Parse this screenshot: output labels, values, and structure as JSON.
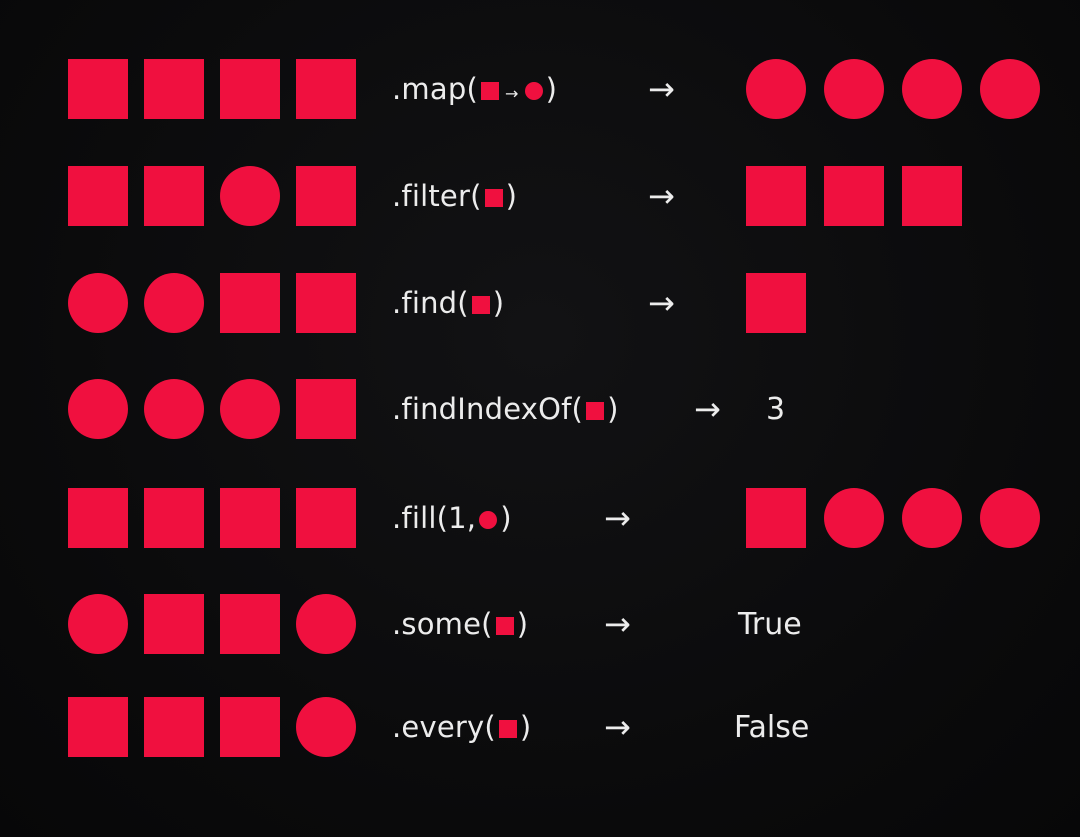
{
  "accent_color": "#f0103f",
  "arrow_glyph": "→",
  "rows": [
    {
      "id": "map",
      "input": [
        "square",
        "square",
        "square",
        "square"
      ],
      "method_prefix": ".map(",
      "method_args": [
        "square",
        "mini-arrow",
        "circle"
      ],
      "mini_arrow": "→",
      "method_suffix": ")",
      "output": [
        "circle",
        "circle",
        "circle",
        "circle"
      ],
      "result_text": ""
    },
    {
      "id": "filter",
      "input": [
        "square",
        "square",
        "circle",
        "square"
      ],
      "method_prefix": ".filter(",
      "method_args": [
        "square"
      ],
      "method_suffix": ")",
      "output": [
        "square",
        "square",
        "square"
      ],
      "result_text": ""
    },
    {
      "id": "find",
      "input": [
        "circle",
        "circle",
        "square",
        "square"
      ],
      "method_prefix": ".find(",
      "method_args": [
        "square"
      ],
      "method_suffix": ")",
      "output": [
        "square"
      ],
      "result_text": ""
    },
    {
      "id": "findIndexOf",
      "input": [
        "circle",
        "circle",
        "circle",
        "square"
      ],
      "method_prefix": ".findIndexOf(",
      "method_args": [
        "square"
      ],
      "method_suffix": ")",
      "output": [],
      "result_text": "3"
    },
    {
      "id": "fill",
      "input": [
        "square",
        "square",
        "square",
        "square"
      ],
      "method_prefix": ".fill(1, ",
      "method_args": [
        "circle"
      ],
      "method_suffix": ")",
      "output": [
        "square",
        "circle",
        "circle",
        "circle"
      ],
      "result_text": ""
    },
    {
      "id": "some",
      "input": [
        "circle",
        "square",
        "square",
        "circle"
      ],
      "method_prefix": ".some(",
      "method_args": [
        "square"
      ],
      "method_suffix": ")",
      "output": [],
      "result_text": "True"
    },
    {
      "id": "every",
      "input": [
        "square",
        "square",
        "square",
        "circle"
      ],
      "method_prefix": ".every(",
      "method_args": [
        "square"
      ],
      "method_suffix": ")",
      "output": [],
      "result_text": "False"
    }
  ]
}
